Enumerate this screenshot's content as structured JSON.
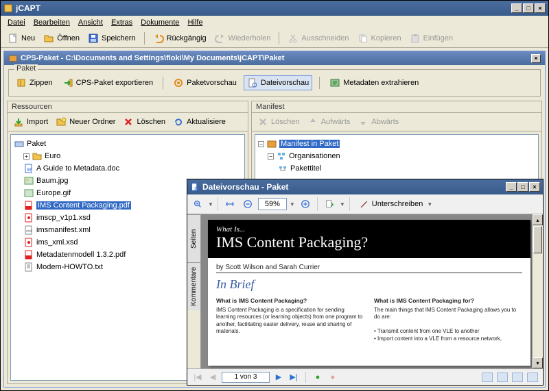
{
  "app": {
    "title": "jCAPT"
  },
  "menu": {
    "file": "Datei",
    "edit": "Bearbeiten",
    "view": "Ansicht",
    "extras": "Extras",
    "documents": "Dokumente",
    "help": "Hilfe"
  },
  "maintb": {
    "new": "Neu",
    "open": "Öffnen",
    "save": "Speichern",
    "undo": "Rückgängig",
    "redo": "Wiederholen",
    "cut": "Ausschneiden",
    "copy": "Kopieren",
    "paste": "Einfügen"
  },
  "sub": {
    "title": "CPS-Paket - C:\\Documents and Settings\\floki\\My Documents\\jCAPT\\Paket"
  },
  "paket": {
    "label": "Paket",
    "zip": "Zippen",
    "export": "CPS-Paket exportieren",
    "preview": "Paketvorschau",
    "filepreview": "Dateivorschau",
    "meta": "Metadaten extrahieren"
  },
  "res": {
    "label": "Ressourcen",
    "import": "Import",
    "newfolder": "Neuer Ordner",
    "delete": "Löschen",
    "refresh": "Aktualisiere",
    "root": "Paket",
    "items": [
      "Euro",
      "A Guide to Metadata.doc",
      "Baum.jpg",
      "Europe.gif",
      "IMS Content Packaging.pdf",
      "imscp_v1p1.xsd",
      "imsmanifest.xml",
      "ims_xml.xsd",
      "Metadatenmodell 1.3.2.pdf",
      "Modem-HOWTO.txt"
    ]
  },
  "man": {
    "label": "Manifest",
    "delete": "Löschen",
    "up": "Aufwärts",
    "down": "Abwärts",
    "root": "Manifest in Paket",
    "org": "Organisationen",
    "title": "Pakettitel"
  },
  "pv": {
    "title": "Dateivorschau - Paket",
    "zoom": "59%",
    "sign": "Unterschreiben",
    "tab_pages": "Seiten",
    "tab_comments": "Kommentare",
    "whatis": "What Is...",
    "pagetitle": "IMS Content Packaging?",
    "authors": "by Scott Wilson and Sarah Currier",
    "brief": "In Brief",
    "h1": "What is IMS Content Packaging?",
    "p1": "IMS Content Packaging is a specification for sending learning resources (or learning objects) from one program to another, facilitating easier delivery, reuse and sharing of materials.",
    "h2": "What is IMS Content Packaging for?",
    "p2": "The main things that IMS Content Packaging allows you to do are:",
    "b1": "• Transmit content from one VLE to another",
    "b2": "• Import content into a VLE from a resource network,",
    "pagenum": "1 von 3"
  }
}
